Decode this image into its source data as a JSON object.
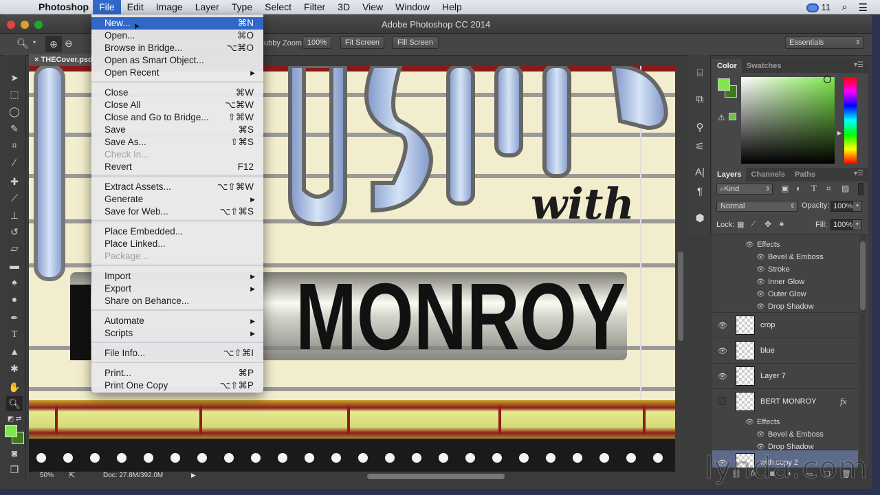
{
  "menubar": {
    "app_name": "Photoshop",
    "items": [
      "File",
      "Edit",
      "Image",
      "Layer",
      "Type",
      "Select",
      "Filter",
      "3D",
      "View",
      "Window",
      "Help"
    ],
    "active": "File",
    "cc_badge": "11"
  },
  "window": {
    "title": "Adobe Photoshop CC 2014"
  },
  "options_bar": {
    "scrubby_zoom_label": "ubby Zoom",
    "btn_100": "100%",
    "btn_fit": "Fit Screen",
    "btn_fill": "Fill Screen",
    "workspace": "Essentials"
  },
  "document": {
    "tab_name": "THECover.psd",
    "zoom": "50%",
    "doc_size": "Doc: 27.8M/392.0M",
    "canvas_text": {
      "script": "with",
      "name": "MONROY"
    }
  },
  "file_menu": {
    "groups": [
      [
        {
          "label": "New...",
          "shortcut": "⌘N",
          "highlighted": true
        },
        {
          "label": "Open...",
          "shortcut": "⌘O"
        },
        {
          "label": "Browse in Bridge...",
          "shortcut": "⌥⌘O"
        },
        {
          "label": "Open as Smart Object...",
          "shortcut": ""
        },
        {
          "label": "Open Recent",
          "shortcut": "",
          "submenu": true
        }
      ],
      [
        {
          "label": "Close",
          "shortcut": "⌘W"
        },
        {
          "label": "Close All",
          "shortcut": "⌥⌘W"
        },
        {
          "label": "Close and Go to Bridge...",
          "shortcut": "⇧⌘W"
        },
        {
          "label": "Save",
          "shortcut": "⌘S"
        },
        {
          "label": "Save As...",
          "shortcut": "⇧⌘S"
        },
        {
          "label": "Check In...",
          "shortcut": "",
          "disabled": true
        },
        {
          "label": "Revert",
          "shortcut": "F12"
        }
      ],
      [
        {
          "label": "Extract Assets...",
          "shortcut": "⌥⇧⌘W"
        },
        {
          "label": "Generate",
          "shortcut": "",
          "submenu": true
        },
        {
          "label": "Save for Web...",
          "shortcut": "⌥⇧⌘S"
        }
      ],
      [
        {
          "label": "Place Embedded...",
          "shortcut": ""
        },
        {
          "label": "Place Linked...",
          "shortcut": ""
        },
        {
          "label": "Package...",
          "shortcut": "",
          "disabled": true
        }
      ],
      [
        {
          "label": "Import",
          "shortcut": "",
          "submenu": true
        },
        {
          "label": "Export",
          "shortcut": "",
          "submenu": true
        },
        {
          "label": "Share on Behance...",
          "shortcut": ""
        }
      ],
      [
        {
          "label": "Automate",
          "shortcut": "",
          "submenu": true
        },
        {
          "label": "Scripts",
          "shortcut": "",
          "submenu": true
        }
      ],
      [
        {
          "label": "File Info...",
          "shortcut": "⌥⇧⌘I"
        }
      ],
      [
        {
          "label": "Print...",
          "shortcut": "⌘P"
        },
        {
          "label": "Print One Copy",
          "shortcut": "⌥⇧⌘P"
        }
      ]
    ]
  },
  "color_panel": {
    "tabs": [
      "Color",
      "Swatches"
    ],
    "foreground": "#7ee84a",
    "background": "#3f7a1c"
  },
  "layers_panel": {
    "tabs": [
      "Layers",
      "Channels",
      "Paths"
    ],
    "filter_kind": "Kind",
    "blend_mode": "Normal",
    "opacity_label": "Opacity:",
    "opacity": "100%",
    "lock_label": "Lock:",
    "fill_label": "Fill:",
    "fill": "100%",
    "top_effects": {
      "label": "Effects",
      "items": [
        "Bevel & Emboss",
        "Stroke",
        "Inner Glow",
        "Outer Glow",
        "Drop Shadow"
      ]
    },
    "layers": [
      {
        "name": "crop",
        "visible": true
      },
      {
        "name": "blue",
        "visible": true
      },
      {
        "name": "Layer 7",
        "visible": true
      },
      {
        "name": "BERT MONROY",
        "visible": false,
        "fx": true
      }
    ],
    "bert_effects": {
      "label": "Effects",
      "items": [
        "Bevel & Emboss",
        "Drop Shadow"
      ]
    },
    "selected_layer": "with copy 2"
  },
  "watermark": "lynda.com"
}
